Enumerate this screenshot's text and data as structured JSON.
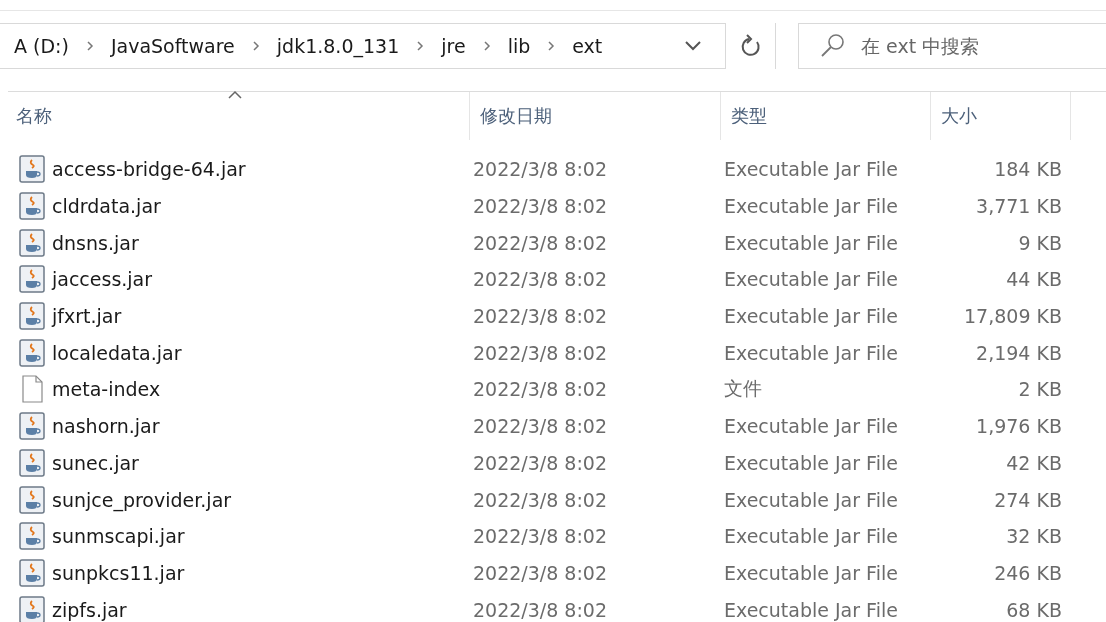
{
  "address_bar": {
    "segments": [
      "A (D:)",
      "JavaSoftware",
      "jdk1.8.0_131",
      "jre",
      "lib",
      "ext"
    ]
  },
  "search": {
    "placeholder": "在 ext 中搜索"
  },
  "table": {
    "columns": [
      {
        "label": "名称",
        "sorted": true
      },
      {
        "label": "修改日期",
        "sorted": false
      },
      {
        "label": "类型",
        "sorted": false
      },
      {
        "label": "大小",
        "sorted": false
      }
    ],
    "rows": [
      {
        "kind": "jar",
        "name": "access-bridge-64.jar",
        "date": "2022/3/8 8:02",
        "type": "Executable Jar File",
        "size": "184 KB"
      },
      {
        "kind": "jar",
        "name": "cldrdata.jar",
        "date": "2022/3/8 8:02",
        "type": "Executable Jar File",
        "size": "3,771 KB"
      },
      {
        "kind": "jar",
        "name": "dnsns.jar",
        "date": "2022/3/8 8:02",
        "type": "Executable Jar File",
        "size": "9 KB"
      },
      {
        "kind": "jar",
        "name": "jaccess.jar",
        "date": "2022/3/8 8:02",
        "type": "Executable Jar File",
        "size": "44 KB"
      },
      {
        "kind": "jar",
        "name": "jfxrt.jar",
        "date": "2022/3/8 8:02",
        "type": "Executable Jar File",
        "size": "17,809 KB"
      },
      {
        "kind": "jar",
        "name": "localedata.jar",
        "date": "2022/3/8 8:02",
        "type": "Executable Jar File",
        "size": "2,194 KB"
      },
      {
        "kind": "file",
        "name": "meta-index",
        "date": "2022/3/8 8:02",
        "type": "文件",
        "size": "2 KB"
      },
      {
        "kind": "jar",
        "name": "nashorn.jar",
        "date": "2022/3/8 8:02",
        "type": "Executable Jar File",
        "size": "1,976 KB"
      },
      {
        "kind": "jar",
        "name": "sunec.jar",
        "date": "2022/3/8 8:02",
        "type": "Executable Jar File",
        "size": "42 KB"
      },
      {
        "kind": "jar",
        "name": "sunjce_provider.jar",
        "date": "2022/3/8 8:02",
        "type": "Executable Jar File",
        "size": "274 KB"
      },
      {
        "kind": "jar",
        "name": "sunmscapi.jar",
        "date": "2022/3/8 8:02",
        "type": "Executable Jar File",
        "size": "32 KB"
      },
      {
        "kind": "jar",
        "name": "sunpkcs11.jar",
        "date": "2022/3/8 8:02",
        "type": "Executable Jar File",
        "size": "246 KB"
      },
      {
        "kind": "jar",
        "name": "zipfs.jar",
        "date": "2022/3/8 8:02",
        "type": "Executable Jar File",
        "size": "68 KB"
      }
    ]
  }
}
